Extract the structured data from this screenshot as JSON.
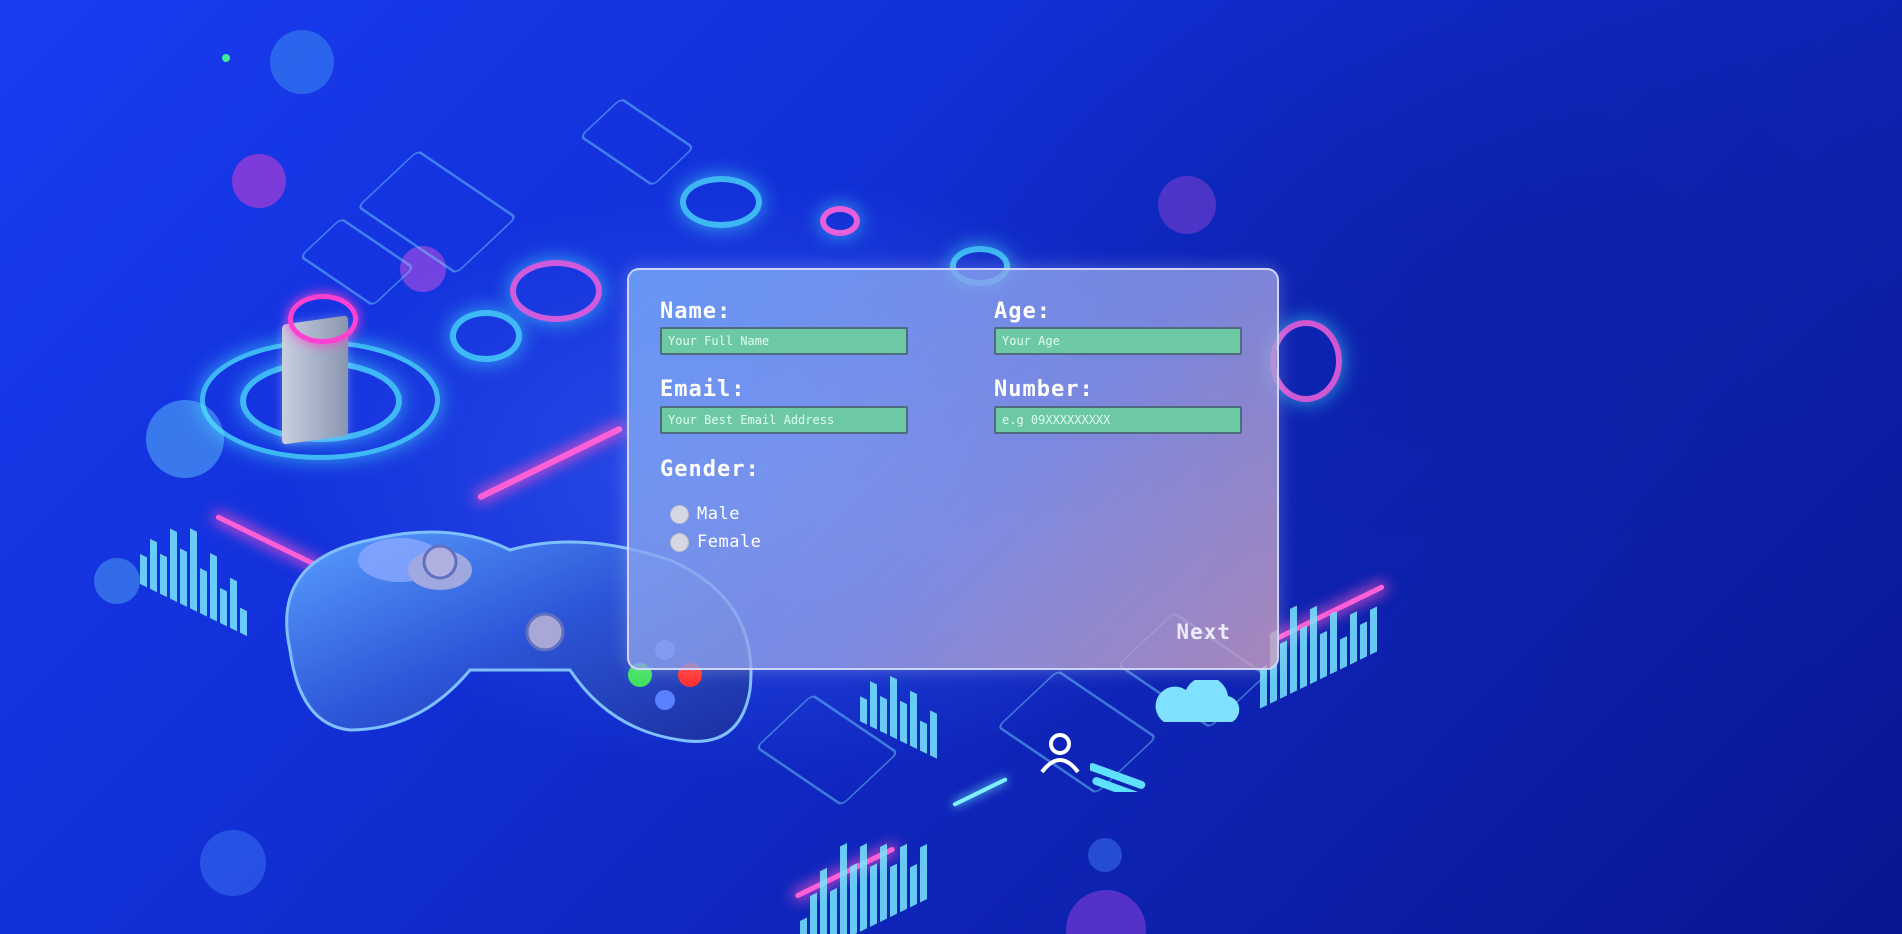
{
  "form": {
    "name_label": "Name:",
    "name_placeholder": "Your Full Name",
    "age_label": "Age:",
    "age_placeholder": "Your Age",
    "email_label": "Email:",
    "email_placeholder": "Your Best Email Address",
    "number_label": "Number:",
    "number_placeholder": "e.g 09XXXXXXXXX",
    "gender_label": "Gender:",
    "gender_options": [
      "Male",
      "Female"
    ],
    "next_label": "Next"
  },
  "colors": {
    "background": "#1230d8",
    "input_fill": "#6cc9a4",
    "panel_tint": "#8aa8f0",
    "neon_pink": "#ff50c8",
    "neon_cyan": "#50f0ff"
  },
  "icons": [
    "gamepad-illustration",
    "server-tower-icon",
    "cloud-icon",
    "user-profile-icon",
    "fingerprint-icon",
    "keyboard-icon"
  ]
}
